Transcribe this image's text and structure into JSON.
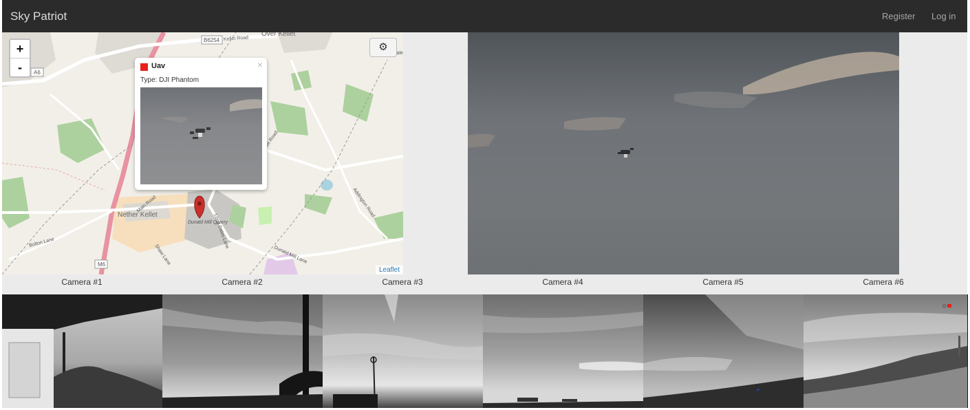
{
  "navbar": {
    "brand": "Sky Patriot",
    "register": "Register",
    "login": "Log in"
  },
  "map": {
    "zoom_in": "+",
    "zoom_out": "-",
    "settings_icon": "gear-icon",
    "attribution": "Leaflet",
    "labels": {
      "b6254": "B6254",
      "kellet_road_top": "Kellet Road",
      "over_kellet": "Over Kellet",
      "a6": "A6",
      "nether_kellet": "Nether Kellet",
      "main_road": "Main Road",
      "dunald_mill_quarry": "Dunald Mill Quarry",
      "long_dales_lane": "Long Dales Lane",
      "kellet_road_mid": "Kellet Road",
      "addington_road": "Addington Road",
      "bolton_lane": "Bolton Lane",
      "shaw_lane": "Shaw Lane",
      "dunald_mill_lane": "Dunald Mill Lane",
      "m6": "M6",
      "jale": "Jale"
    },
    "popup": {
      "close": "×",
      "title": "Uav",
      "type_line": "Type: DJI Phantom",
      "marker_color": "#e8201c"
    }
  },
  "cameras": [
    "Camera #1",
    "Camera #2",
    "Camera #3",
    "Camera #4",
    "Camera #5",
    "Camera #6"
  ],
  "thumb6_overlay_color": "#e8201c"
}
